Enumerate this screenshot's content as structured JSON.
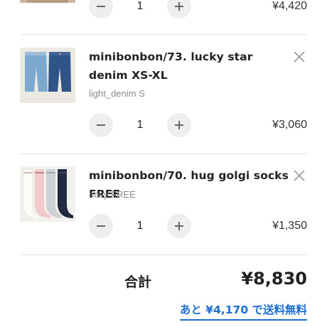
{
  "colors": {
    "accent": "#1f6fd0",
    "text": "#222222",
    "muted": "#8a8a8a",
    "stepper_bg": "#eeeeee"
  },
  "icons": {
    "remove": "close-icon",
    "decrease": "minus-icon",
    "increase": "plus-icon"
  },
  "cart": {
    "items": [
      {
        "quantity": "1",
        "price": "¥4,420"
      },
      {
        "title": "minibonbon/73. lucky star denim XS-XL",
        "variant": "light_denim S",
        "quantity": "1",
        "price": "¥3,060"
      },
      {
        "title": "minibonbon/70. hug golgi socks FREE",
        "variant": "navy FREE",
        "quantity": "1",
        "price": "¥1,350"
      }
    ]
  },
  "summary": {
    "total_label": "合計",
    "total_value": "¥8,830",
    "free_shipping_text": "あと ¥4,170 で送料無料"
  }
}
